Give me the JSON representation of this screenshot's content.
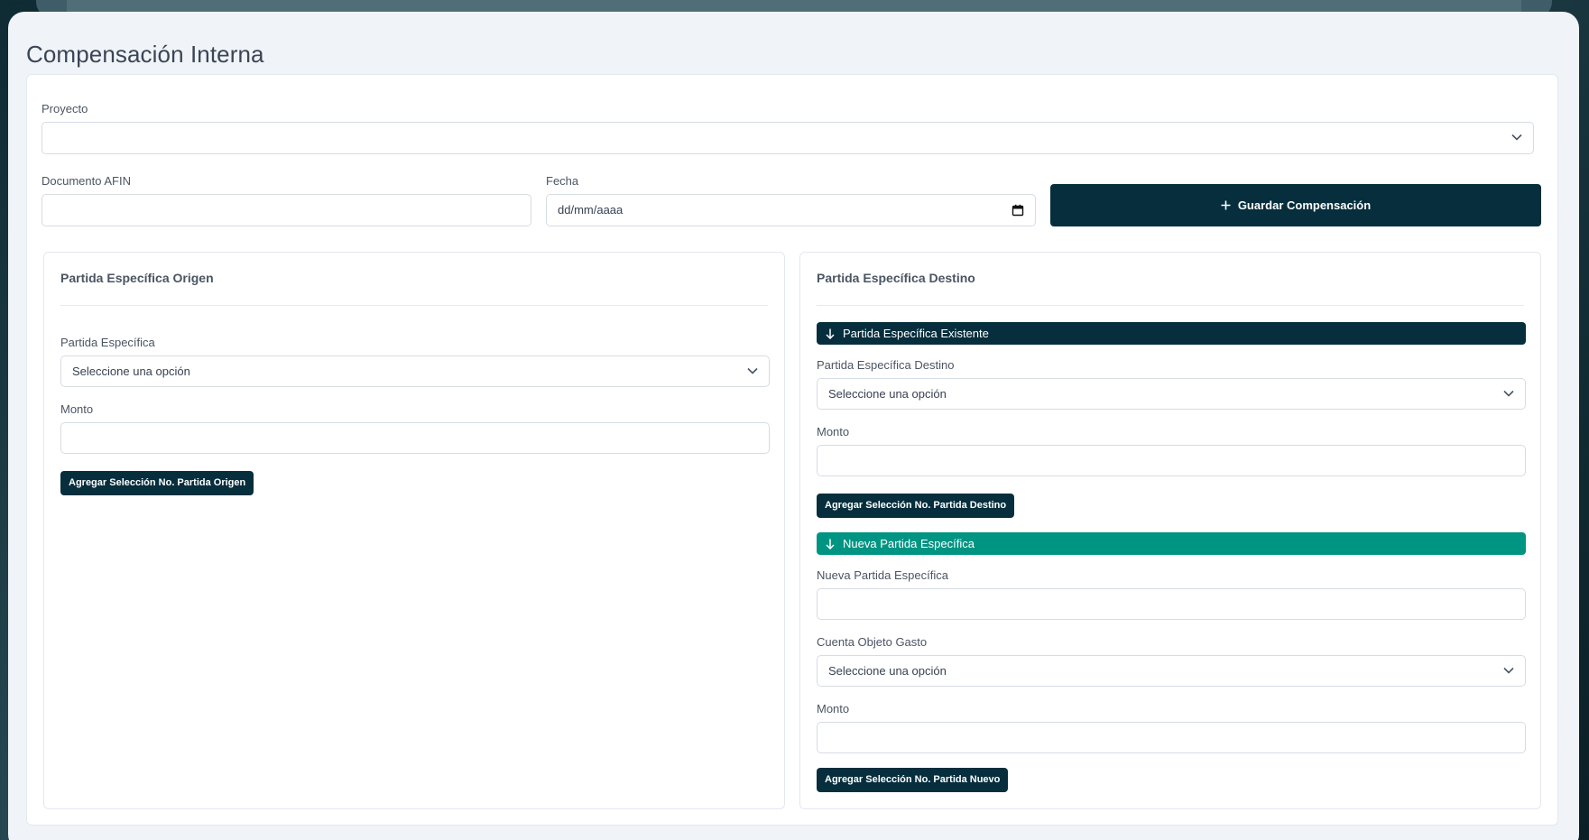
{
  "page": {
    "title": "Compensación Interna"
  },
  "form": {
    "proyecto": {
      "label": "Proyecto",
      "value": ""
    },
    "documento": {
      "label": "Documento AFIN",
      "value": ""
    },
    "fecha": {
      "label": "Fecha",
      "placeholder": "dd/mm/aaaa"
    },
    "save_button": "Guardar Compensación"
  },
  "origen": {
    "title": "Partida Específica Origen",
    "partida_label": "Partida Específica",
    "partida_value": "Seleccione una opción",
    "monto_label": "Monto",
    "add_button": "Agregar Selección No. Partida Origen"
  },
  "destino": {
    "title": "Partida Específica Destino",
    "existente": {
      "section_label": "Partida Específica Existente",
      "partida_label": "Partida Específica Destino",
      "partida_value": "Seleccione una opción",
      "monto_label": "Monto",
      "add_button": "Agregar Selección No. Partida Destino"
    },
    "nueva": {
      "section_label": "Nueva Partida Específica",
      "partida_label": "Nueva Partida Específica",
      "cuenta_label": "Cuenta Objeto Gasto",
      "cuenta_value": "Seleccione una opción",
      "monto_label": "Monto",
      "add_button": "Agregar Selección No. Partida Nuevo"
    }
  },
  "colors": {
    "primary": "#062e3d",
    "accent_teal": "#009483",
    "background": "#f0f4f8"
  }
}
